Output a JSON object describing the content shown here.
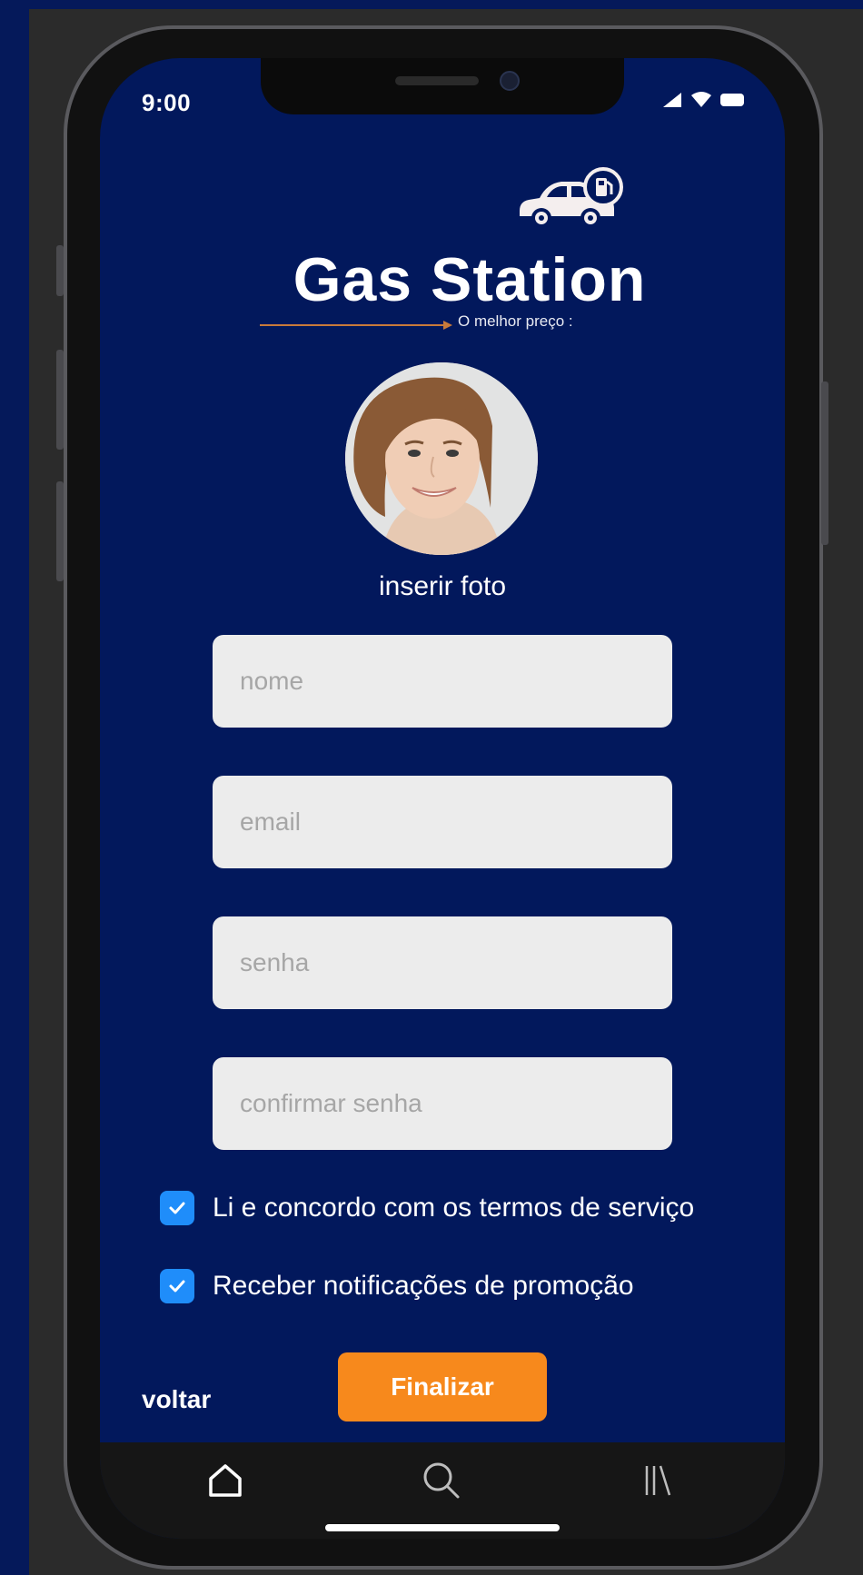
{
  "status_bar": {
    "time": "9:00"
  },
  "logo": {
    "title": "Gas Station",
    "slogan": "O melhor preço :"
  },
  "avatar": {
    "action_label": "inserir foto"
  },
  "form": {
    "name_placeholder": "nome",
    "email_placeholder": "email",
    "password_placeholder": "senha",
    "confirm_password_placeholder": "confirmar senha",
    "terms_label": "Li e concordo com os termos de serviço",
    "terms_checked": true,
    "promo_label": "Receber notificações de promoção",
    "promo_checked": true
  },
  "actions": {
    "back_label": "voltar",
    "finish_label": "Finalizar"
  },
  "tabbar": {
    "items": [
      "home-icon",
      "search-icon",
      "library-icon"
    ]
  },
  "colors": {
    "background": "#02185c",
    "accent": "#f7891c",
    "checkbox": "#1f8dfa",
    "field": "#ececec",
    "tabbar": "#161616"
  }
}
